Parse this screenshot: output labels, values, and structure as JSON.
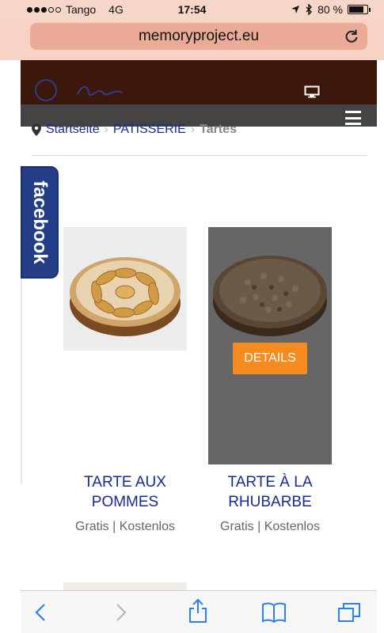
{
  "status_bar": {
    "carrier": "Tango",
    "network": "4G",
    "time": "17:54",
    "battery_percent": "80 %",
    "battery_level": 0.8,
    "signal_bars_filled": 3,
    "signal_bars_total": 5
  },
  "browser": {
    "url": "memoryproject.eu"
  },
  "breadcrumb": {
    "home": "Startseite",
    "category": "PATISSERIE",
    "current": "Tartes"
  },
  "facebook_tab": {
    "label": "facebook"
  },
  "products": [
    {
      "title": "TARTE AUX POMMES",
      "price": "Gratis | Kostenlos"
    },
    {
      "title": "TARTE À LA RHUBARBE",
      "price": "Gratis | Kostenlos",
      "details_label": "DETAILS"
    }
  ],
  "colors": {
    "header_brown": "#3c170b",
    "link_blue": "#1b2a8a",
    "details_orange": "#f68b1f",
    "facebook_blue": "#233e86",
    "safari_blue": "#2f80ed"
  }
}
